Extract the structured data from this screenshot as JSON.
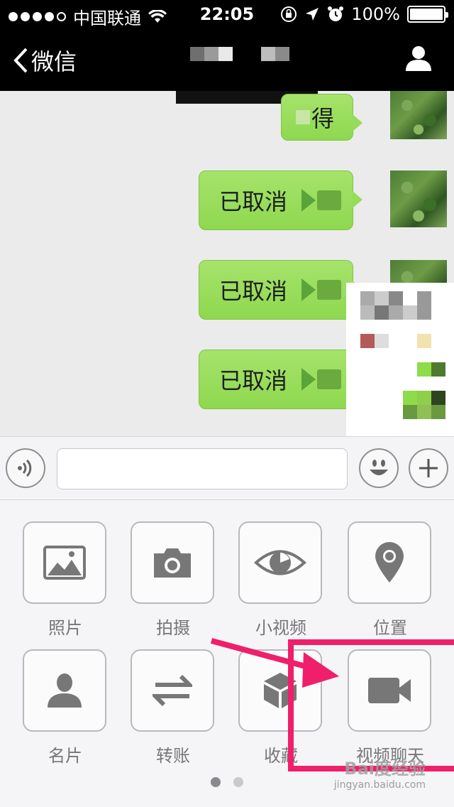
{
  "status_bar": {
    "carrier": "中国联通",
    "time": "22:05",
    "battery": "100%",
    "battery_level": 1.0,
    "signal_bars": 4
  },
  "nav": {
    "back_label": "微信",
    "title": "",
    "profile_icon": "person-icon"
  },
  "chat": {
    "partial_message": "得",
    "messages": [
      {
        "text": "已取消",
        "icon": "video-call-icon"
      },
      {
        "text": "已取消",
        "icon": "video-call-icon"
      },
      {
        "text": "已取消",
        "icon": "video-call-icon"
      }
    ]
  },
  "input_bar": {
    "voice_icon": "voice-icon",
    "emoji_icon": "emoji-icon",
    "plus_icon": "plus-icon",
    "text_value": ""
  },
  "tools": [
    {
      "label": "照片",
      "icon": "photo-icon"
    },
    {
      "label": "拍摄",
      "icon": "camera-icon"
    },
    {
      "label": "小视频",
      "icon": "eye-icon"
    },
    {
      "label": "位置",
      "icon": "location-icon"
    },
    {
      "label": "名片",
      "icon": "contact-card-icon"
    },
    {
      "label": "转账",
      "icon": "transfer-icon"
    },
    {
      "label": "收藏",
      "icon": "favorites-icon"
    },
    {
      "label": "视频聊天",
      "icon": "video-chat-icon"
    }
  ],
  "page_indicator": {
    "count": 2,
    "active": 0
  },
  "watermark": {
    "brand": "Bai度经验",
    "url": "jingyan.baidu.com"
  },
  "colors": {
    "bubble": "#96dc58",
    "annotation": "#ef1f6b",
    "nav_bg": "#000000"
  }
}
